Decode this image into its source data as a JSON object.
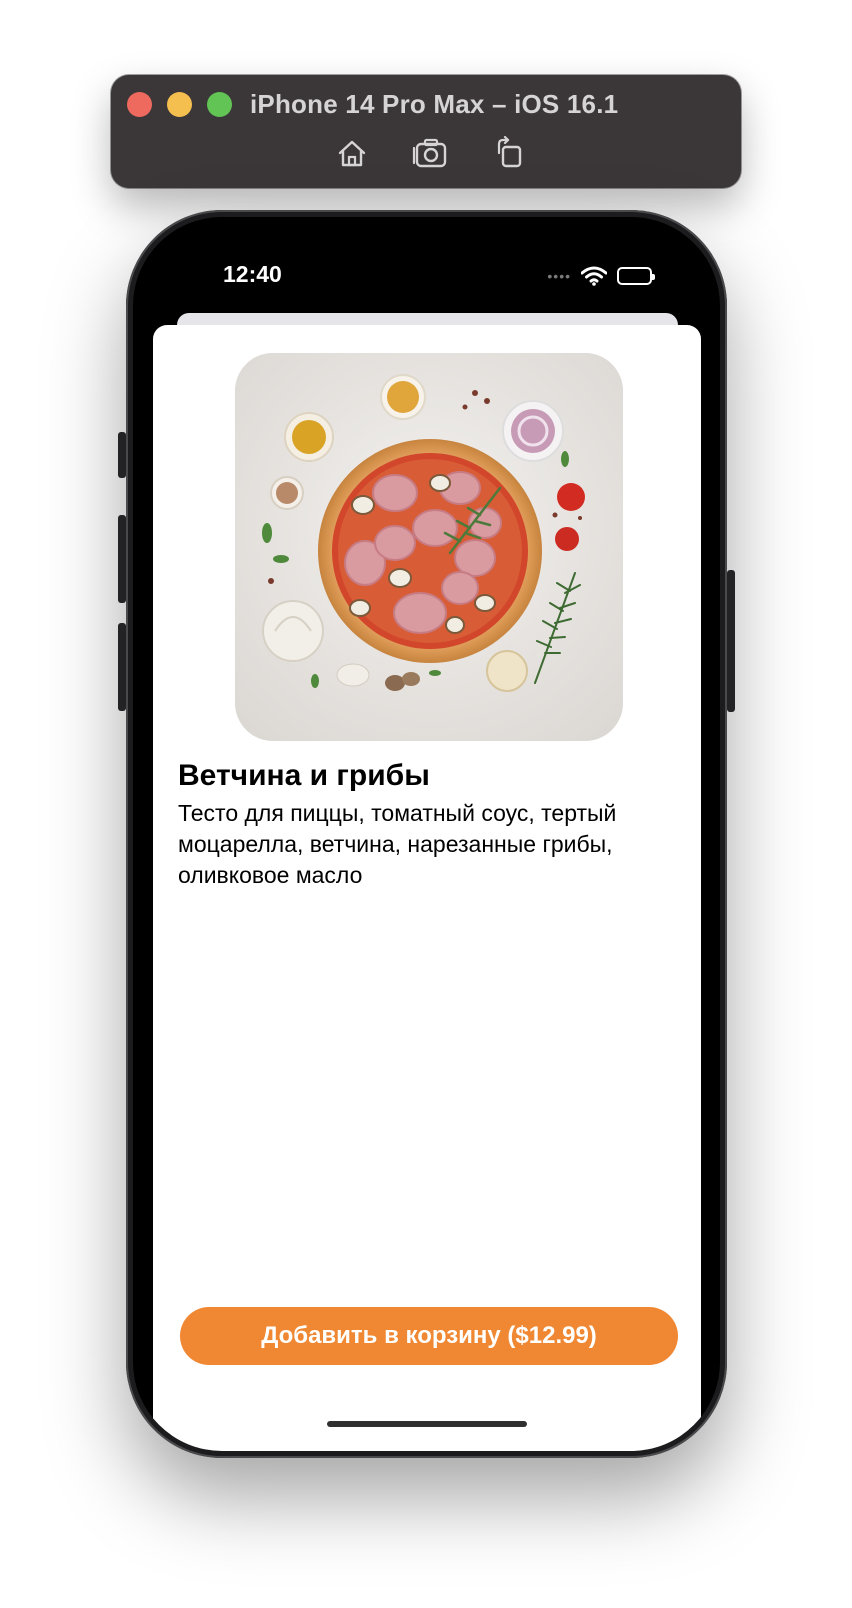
{
  "simulator": {
    "title": "iPhone 14 Pro Max – iOS 16.1",
    "toolbar": [
      {
        "icon": "home-icon"
      },
      {
        "icon": "screenshot-icon"
      },
      {
        "icon": "rotate-icon"
      }
    ]
  },
  "status_bar": {
    "time": "12:40",
    "signal": "••••",
    "icons": [
      "wifi-icon",
      "battery-icon"
    ]
  },
  "product": {
    "image_alt": "pizza-image",
    "title": "Ветчина и грибы",
    "description": "Тесто для пиццы, томатный соус, тертый моцарелла, ветчина, нарезанные грибы, оливковое масло"
  },
  "actions": {
    "add_to_cart_label": "Добавить в корзину ($12.99)"
  },
  "colors": {
    "accent": "#f08833",
    "simulator_bar": "#3b3739"
  }
}
